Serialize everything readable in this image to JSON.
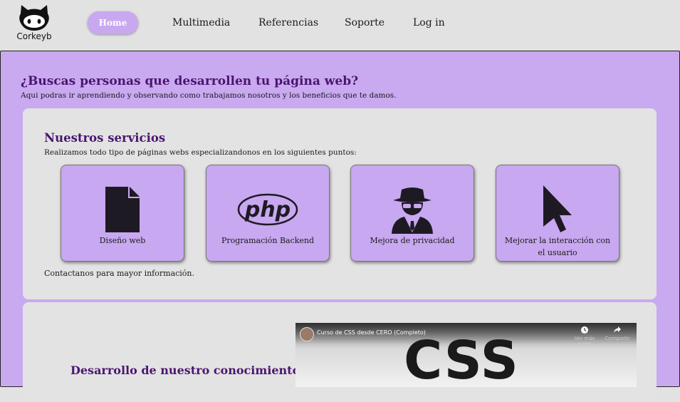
{
  "brand": {
    "name": "Corkeyb",
    "logo_icon": "octocat-icon"
  },
  "nav": {
    "items": [
      {
        "label": "Home",
        "active": true
      },
      {
        "label": "Multimedia"
      },
      {
        "label": "Referencias"
      },
      {
        "label": "Soporte"
      },
      {
        "label": "Log in"
      }
    ]
  },
  "hero": {
    "title": "¿Buscas personas que desarrollen tu página web?",
    "subtitle": "Aqui podras ir aprendiendo y observando como trabajamos nosotros y los beneficios que te damos."
  },
  "services": {
    "title": "Nuestros servicios",
    "subtitle": "Realizamos todo tipo de páginas webs especializandonos en los siguientes puntos:",
    "items": [
      {
        "label": "Diseño web",
        "icon": "file-icon"
      },
      {
        "label": "Programación Backend",
        "icon": "php-icon"
      },
      {
        "label": "Mejora de privacidad",
        "icon": "spy-icon"
      },
      {
        "label": "Mejorar la interacción con el usuario",
        "icon": "cursor-icon"
      }
    ],
    "contact": "Contactanos para mayor información."
  },
  "knowledge": {
    "title": "Desarrollo de nuestro conocimiento",
    "video": {
      "title": "Curso de CSS desde CERO (Completo)",
      "watch_later": "Ver más tarde",
      "share": "Compartir",
      "thumbnail_text": "CSS"
    }
  },
  "colors": {
    "accent": "#c9a9f0",
    "heading": "#4b1570",
    "card": "#e3e3e3"
  }
}
